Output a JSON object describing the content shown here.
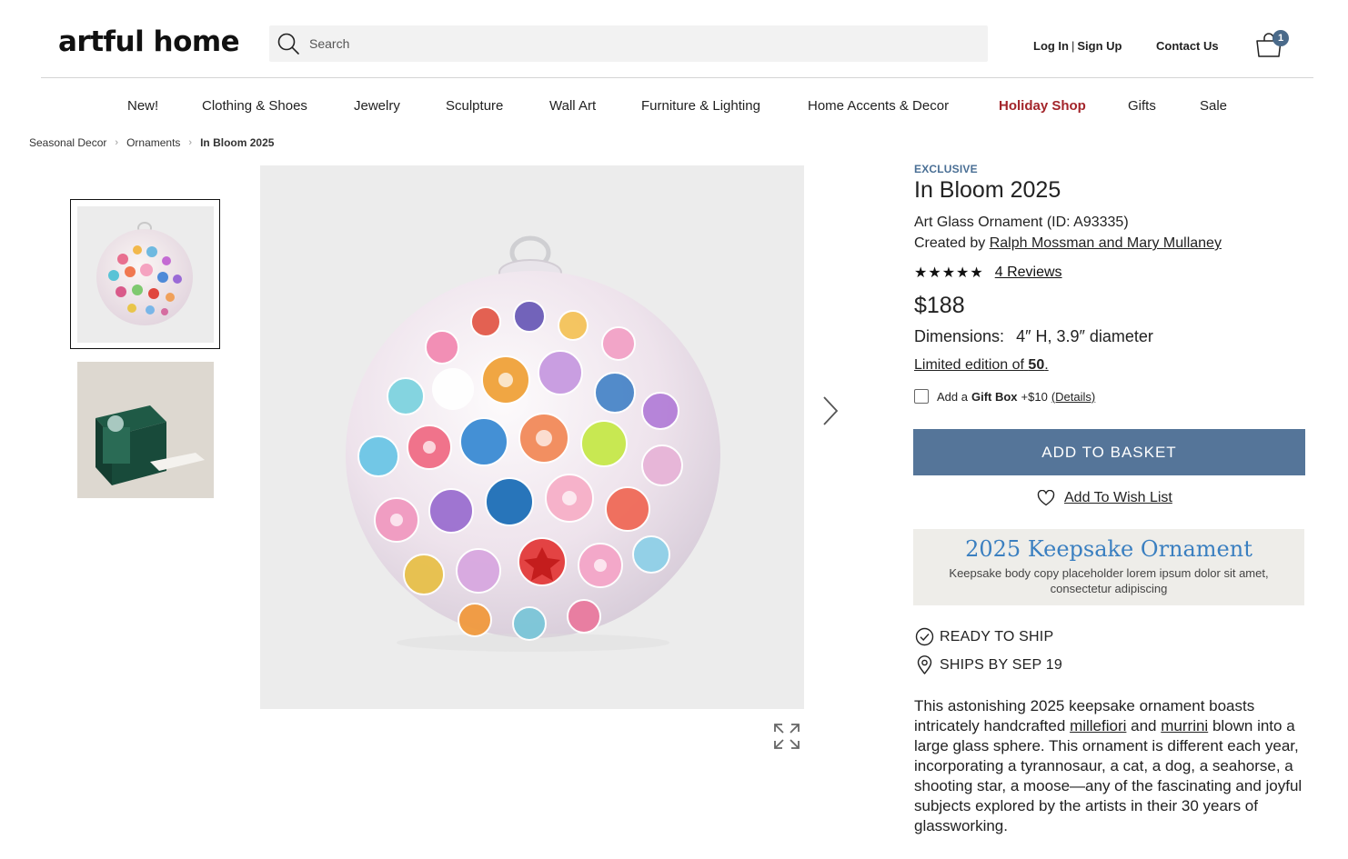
{
  "header": {
    "logo": "artful home",
    "search_placeholder": "Search",
    "login": "Log In",
    "separator": "|",
    "signup": "Sign Up",
    "contact": "Contact Us",
    "cart_count": "1"
  },
  "nav": {
    "items": [
      "New!",
      "Clothing & Shoes",
      "Jewelry",
      "Sculpture",
      "Wall Art",
      "Furniture & Lighting",
      "Home Accents & Decor",
      "Holiday Shop",
      "Gifts",
      "Sale"
    ]
  },
  "breadcrumb": {
    "items": [
      "Seasonal Decor",
      "Ornaments",
      "In Bloom 2025"
    ]
  },
  "product": {
    "badge": "EXCLUSIVE",
    "title": "In Bloom 2025",
    "subtitle": "Art Glass Ornament (ID: A93335)",
    "created_by_label": "Created by",
    "artists": "Ralph Mossman and Mary Mullaney",
    "stars": "★★★★★",
    "rating": 5,
    "reviews": "4 Reviews",
    "price": "$188",
    "dimensions_label": "Dimensions:",
    "dimensions_value": "4″ H, 3.9″ diameter",
    "edition_prefix": "Limited edition of",
    "edition_number": "50",
    "edition_suffix": ".",
    "giftbox_prefix": "Add a",
    "giftbox_bold": "Gift Box",
    "giftbox_price": "+$10",
    "giftbox_details": "(Details)",
    "add_to_basket": "ADD TO BASKET",
    "wishlist": "Add To Wish List"
  },
  "keepsake": {
    "title": "2025 Keepsake Ornament",
    "body": "Keepsake body copy placeholder lorem ipsum dolor sit amet, consectetur adipiscing"
  },
  "shipping": {
    "ready": "READY TO SHIP",
    "ships_by": "SHIPS BY SEP 19"
  },
  "description": {
    "part1": "This astonishing 2025 keepsake ornament boasts intricately handcrafted",
    "link1": "millefiori",
    "and": "and",
    "link2": "murrini",
    "part2": "blown into a large glass sphere. This ornament is different each year, incorporating a tyrannosaur, a cat, a dog, a seahorse, a shooting star, a moose—any of the fascinating and joyful subjects explored by the artists in their 30 years of glassworking."
  },
  "colors": {
    "accent": "#557599",
    "holiday": "#a3242a",
    "exclusive": "#4a6f95",
    "keepsake_title": "#3a7fc0"
  },
  "icons": {
    "search": "search-icon",
    "cart": "shopping-bag-icon",
    "next": "chevron-right-icon",
    "expand": "expand-icon",
    "heart": "heart-icon",
    "check": "check-circle-icon",
    "location": "location-pin-icon"
  }
}
